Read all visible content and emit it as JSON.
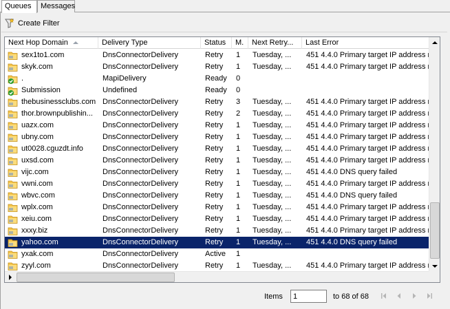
{
  "tabs": [
    {
      "label": "Queues",
      "active": true
    },
    {
      "label": "Messages",
      "active": false
    }
  ],
  "toolbar": {
    "create_filter_label": "Create Filter",
    "icon": "funnel-icon"
  },
  "columns": {
    "domain": "Next Hop Domain",
    "type": "Delivery Type",
    "status": "Status",
    "m": "M.",
    "retry": "Next Retry...",
    "error": "Last Error"
  },
  "sort": {
    "column": "domain",
    "direction": "ascending"
  },
  "rows": [
    {
      "domain": "sex1to1.com",
      "icon": "folder-icon",
      "type": "DnsConnectorDelivery",
      "status": "Retry",
      "m": "1",
      "retry": "Tuesday, ...",
      "error": "451 4.4.0 Primary target IP address r"
    },
    {
      "domain": "skyk.com",
      "icon": "folder-icon",
      "type": "DnsConnectorDelivery",
      "status": "Retry",
      "m": "1",
      "retry": "Tuesday, ...",
      "error": "451 4.4.0 Primary target IP address r"
    },
    {
      "domain": ".",
      "icon": "folder-check-icon",
      "type": "MapiDelivery",
      "status": "Ready",
      "m": "0",
      "retry": "",
      "error": ""
    },
    {
      "domain": "Submission",
      "icon": "folder-check-icon",
      "type": "Undefined",
      "status": "Ready",
      "m": "0",
      "retry": "",
      "error": ""
    },
    {
      "domain": "thebusinessclubs.com",
      "icon": "folder-icon",
      "type": "DnsConnectorDelivery",
      "status": "Retry",
      "m": "3",
      "retry": "Tuesday, ...",
      "error": "451 4.4.0 Primary target IP address r"
    },
    {
      "domain": "thor.brownpublishin...",
      "icon": "folder-icon",
      "type": "DnsConnectorDelivery",
      "status": "Retry",
      "m": "2",
      "retry": "Tuesday, ...",
      "error": "451 4.4.0 Primary target IP address r"
    },
    {
      "domain": "uazx.com",
      "icon": "folder-icon",
      "type": "DnsConnectorDelivery",
      "status": "Retry",
      "m": "1",
      "retry": "Tuesday, ...",
      "error": "451 4.4.0 Primary target IP address r"
    },
    {
      "domain": "ubny.com",
      "icon": "folder-icon",
      "type": "DnsConnectorDelivery",
      "status": "Retry",
      "m": "1",
      "retry": "Tuesday, ...",
      "error": "451 4.4.0 Primary target IP address r"
    },
    {
      "domain": "ut0028.cguzdt.info",
      "icon": "folder-icon",
      "type": "DnsConnectorDelivery",
      "status": "Retry",
      "m": "1",
      "retry": "Tuesday, ...",
      "error": "451 4.4.0 Primary target IP address r"
    },
    {
      "domain": "uxsd.com",
      "icon": "folder-icon",
      "type": "DnsConnectorDelivery",
      "status": "Retry",
      "m": "1",
      "retry": "Tuesday, ...",
      "error": "451 4.4.0 Primary target IP address r"
    },
    {
      "domain": "vijc.com",
      "icon": "folder-icon",
      "type": "DnsConnectorDelivery",
      "status": "Retry",
      "m": "1",
      "retry": "Tuesday, ...",
      "error": "451 4.4.0 DNS query failed"
    },
    {
      "domain": "vwni.com",
      "icon": "folder-icon",
      "type": "DnsConnectorDelivery",
      "status": "Retry",
      "m": "1",
      "retry": "Tuesday, ...",
      "error": "451 4.4.0 Primary target IP address r"
    },
    {
      "domain": "wbvc.com",
      "icon": "folder-icon",
      "type": "DnsConnectorDelivery",
      "status": "Retry",
      "m": "1",
      "retry": "Tuesday, ...",
      "error": "451 4.4.0 DNS query failed"
    },
    {
      "domain": "wplx.com",
      "icon": "folder-icon",
      "type": "DnsConnectorDelivery",
      "status": "Retry",
      "m": "1",
      "retry": "Tuesday, ...",
      "error": "451 4.4.0 Primary target IP address r"
    },
    {
      "domain": "xeiu.com",
      "icon": "folder-icon",
      "type": "DnsConnectorDelivery",
      "status": "Retry",
      "m": "1",
      "retry": "Tuesday, ...",
      "error": "451 4.4.0 Primary target IP address r"
    },
    {
      "domain": "xxxy.biz",
      "icon": "folder-icon",
      "type": "DnsConnectorDelivery",
      "status": "Retry",
      "m": "1",
      "retry": "Tuesday, ...",
      "error": "451 4.4.0 Primary target IP address r"
    },
    {
      "domain": "yahoo.com",
      "icon": "folder-icon",
      "type": "DnsConnectorDelivery",
      "status": "Retry",
      "m": "1",
      "retry": "Tuesday, ...",
      "error": "451 4.4.0 DNS query failed",
      "selected": true
    },
    {
      "domain": "yxak.com",
      "icon": "folder-icon",
      "type": "DnsConnectorDelivery",
      "status": "Active",
      "m": "1",
      "retry": "",
      "error": ""
    },
    {
      "domain": "zyyl.com",
      "icon": "folder-icon",
      "type": "DnsConnectorDelivery",
      "status": "Retry",
      "m": "1",
      "retry": "Tuesday, ...",
      "error": "451 4.4.0 Primary target IP address r"
    }
  ],
  "footer": {
    "items_label": "Items",
    "items_value": "1",
    "range_label": "to 68 of 68"
  },
  "colors": {
    "selection": "#0a246a",
    "folder": "#f5c54a",
    "check": "#2e9d2e"
  }
}
